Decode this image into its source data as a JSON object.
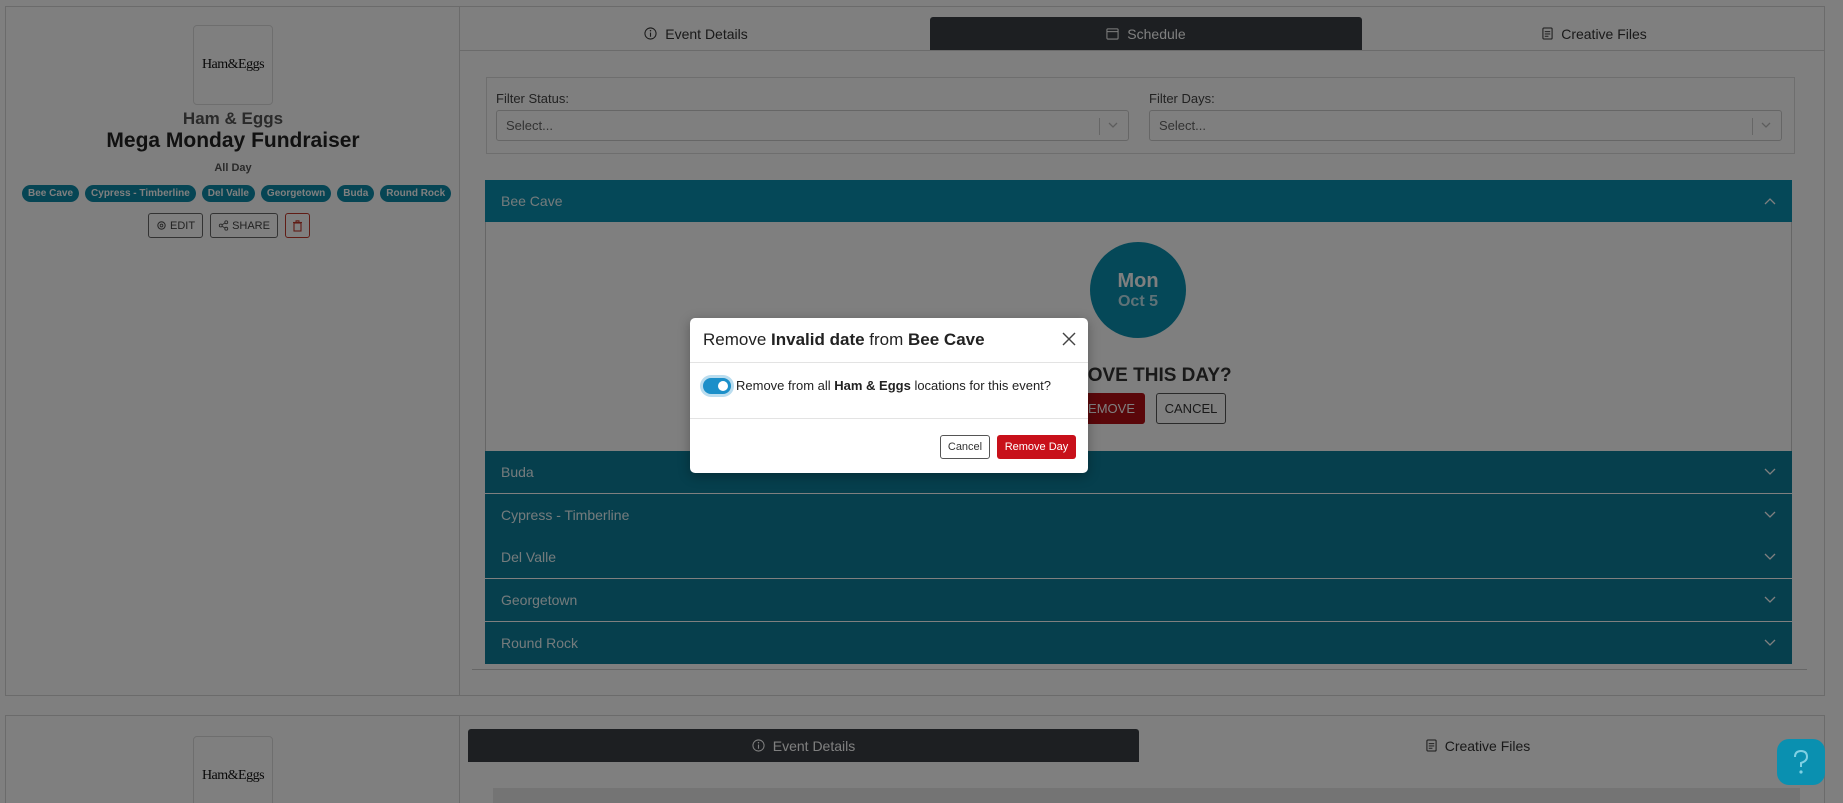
{
  "event_card": {
    "logo_text": "Ham&Eggs",
    "brand": "Ham & Eggs",
    "title": "Mega Monday Fundraiser",
    "time": "All Day",
    "tags": [
      "Bee Cave",
      "Cypress - Timberline",
      "Del Valle",
      "Georgetown",
      "Buda",
      "Round Rock"
    ],
    "actions": {
      "edit": "EDIT",
      "share": "SHARE"
    },
    "tabs": [
      {
        "label": "Event Details",
        "icon": "info-icon"
      },
      {
        "label": "Schedule",
        "icon": "calendar-icon"
      },
      {
        "label": "Creative Files",
        "icon": "document-icon"
      }
    ],
    "active_tab": "Schedule",
    "filters": {
      "status_label": "Filter Status:",
      "status_placeholder": "Select...",
      "days_label": "Filter Days:",
      "days_placeholder": "Select..."
    },
    "locations": [
      "Bee Cave",
      "Buda",
      "Cypress - Timberline",
      "Del Valle",
      "Georgetown",
      "Round Rock"
    ],
    "open_location": {
      "name": "Bee Cave",
      "day_of_week": "Mon",
      "date": "Oct 5",
      "confirm_question": "HOVE THIS DAY?",
      "remove_label": "EMOVE",
      "cancel_label": "CANCEL"
    }
  },
  "second_card": {
    "logo_text": "Ham&Eggs",
    "tabs": [
      {
        "label": "Event Details",
        "icon": "info-icon"
      },
      {
        "label": "Creative Files",
        "icon": "document-icon"
      }
    ],
    "active_tab": "Event Details"
  },
  "modal": {
    "title_prefix": "Remove ",
    "title_target": "Invalid date",
    "title_mid": " from ",
    "title_location": "Bee Cave",
    "body_prefix": "Remove from all ",
    "body_brand": "Ham & Eggs",
    "body_suffix": " locations for this event?",
    "toggle_on": true,
    "cancel_label": "Cancel",
    "confirm_label": "Remove Day"
  },
  "help_button": {
    "label": "?",
    "icon": "help-icon"
  },
  "colors": {
    "accent": "#0a90b0",
    "accordion": "#0d7f9b",
    "danger": "#c8101a",
    "tab_active": "#3a3f45"
  }
}
